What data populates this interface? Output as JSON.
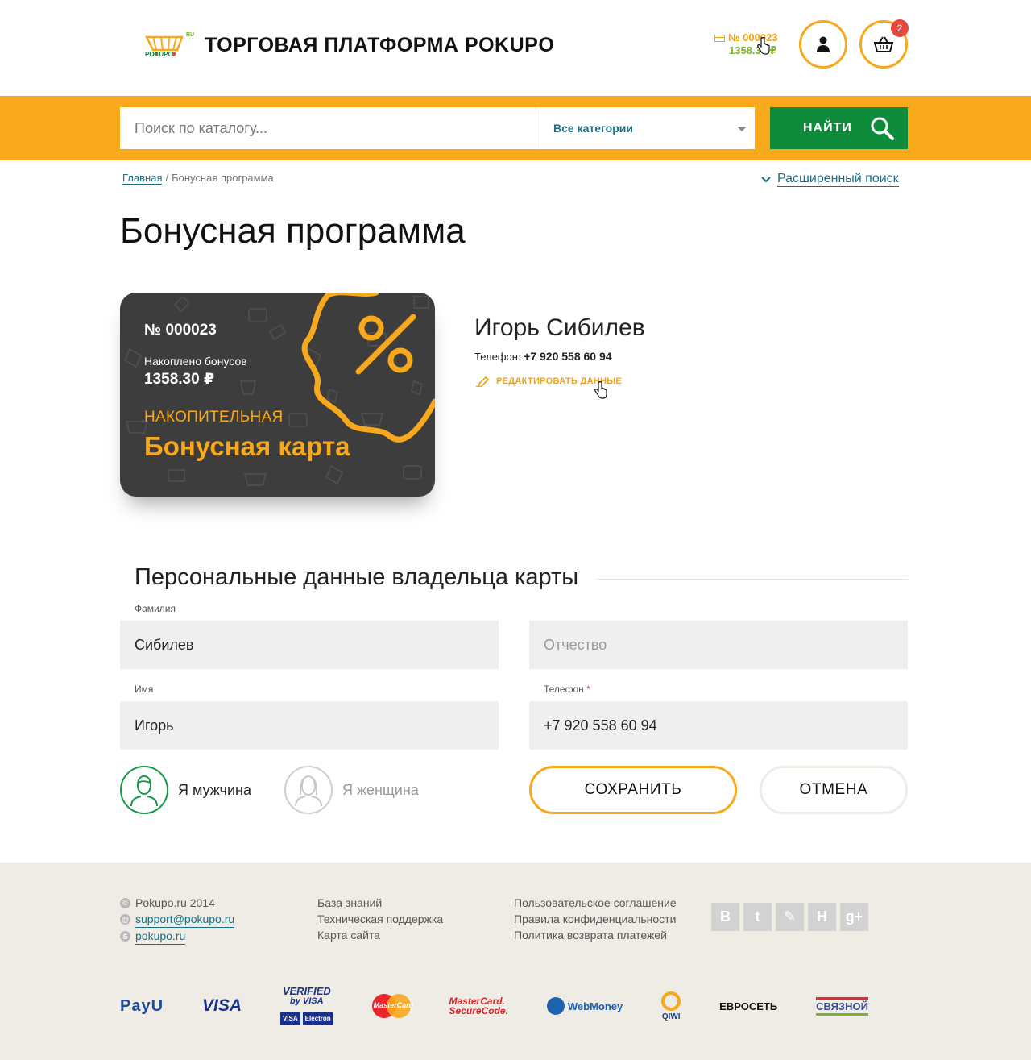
{
  "header": {
    "site_title": "ТОРГОВАЯ ПЛАТФОРМА POKUPO",
    "logo_text": "POKUPO",
    "logo_tld": "RU",
    "card_number": "№ 000023",
    "card_balance": "1358.30 ₽",
    "cart_count": "2"
  },
  "search": {
    "placeholder": "Поиск по каталогу...",
    "category": "Все категории",
    "button": "НАЙТИ"
  },
  "breadcrumb": {
    "home": "Главная",
    "separator": "/",
    "current": "Бонусная программа"
  },
  "advanced_search": "Расширенный поиск",
  "page_title": "Бонусная программа",
  "card": {
    "number": "№ 000023",
    "accumulated_label": "Накоплено бонусов",
    "accumulated_value": "1358.30 ₽",
    "kind": "НАКОПИТЕЛЬНАЯ",
    "name": "Бонусная карта"
  },
  "owner": {
    "name": "Игорь Сибилев",
    "phone_label": "Телефон:",
    "phone": "+7 920 558 60 94",
    "edit_link": "РЕДАКТИРОВАТЬ ДАННЫЕ"
  },
  "form": {
    "section_title": "Персональные данные владельца карты",
    "lastname_label": "Фамилия",
    "lastname_value": "Сибилев",
    "middlename_placeholder": "Отчество",
    "firstname_label": "Имя",
    "firstname_value": "Игорь",
    "phone_label": "Телефон",
    "phone_required": "*",
    "phone_value": "+7 920 558 60 94",
    "gender_male": "Я мужчина",
    "gender_female": "Я женщина",
    "selected_gender": "male",
    "save": "СОХРАНИТЬ",
    "cancel": "ОТМЕНА"
  },
  "footer": {
    "copyright": "Pokupo.ru 2014",
    "email": "support@pokupo.ru",
    "skype": "pokupo.ru",
    "links_col2": [
      "База знаний",
      "Техническая поддержка",
      "Карта сайта"
    ],
    "links_col3": [
      "Пользовательское соглашение",
      "Правила конфиденциальности",
      "Политика возврата платежей"
    ],
    "social": [
      "В",
      "t",
      "✎",
      "H",
      "g+"
    ],
    "payments": {
      "payu": "PayU",
      "visa": "VISA",
      "verified": "VERIFIED",
      "verified_by": "by VISA",
      "visa_small": "VISA",
      "visa_electron": "Electron",
      "mastercard": "MasterCard",
      "securecode_1": "MasterCard.",
      "securecode_2": "SecureCode.",
      "webmoney": "WebMoney",
      "qiwi": "QIWI",
      "evroset": "ЕВРОСЕТЬ",
      "svyaznoy": "СВЯЗНОЙ"
    }
  },
  "colors": {
    "accent_orange": "#f7a81b",
    "brand_green": "#0f8b3c",
    "link_blue": "#1a6f86",
    "card_dark": "#3d3d3d"
  }
}
